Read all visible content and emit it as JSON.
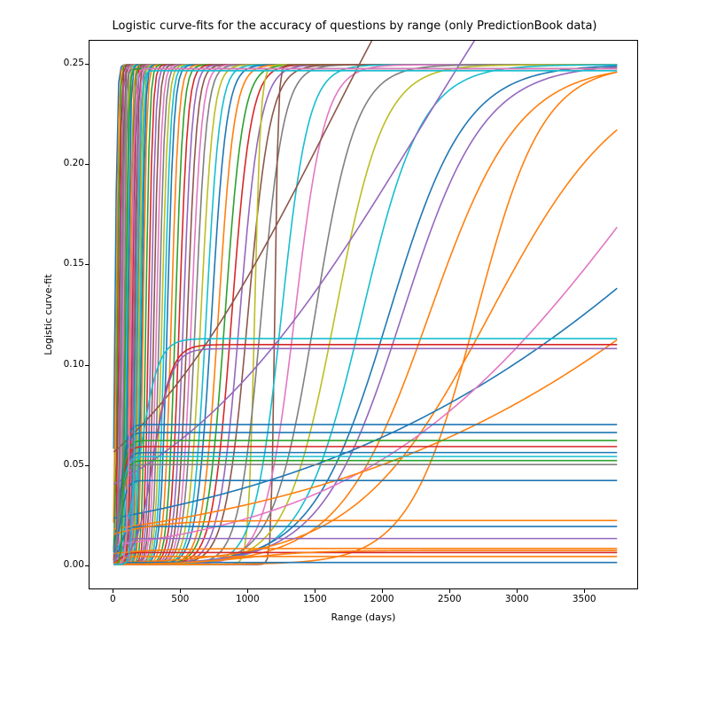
{
  "chart_data": {
    "type": "line",
    "title": "Logistic curve-fits for the accuracy of questions by range (only PredictionBook data)",
    "xlabel": "Range (days)",
    "ylabel": "Logistic curve-fit",
    "xlim": [
      -180,
      3900
    ],
    "ylim": [
      -0.012,
      0.262
    ],
    "xticks": [
      0,
      500,
      1000,
      1500,
      2000,
      2500,
      3000,
      3500
    ],
    "yticks": [
      0.0,
      0.05,
      0.1,
      0.15,
      0.2,
      0.25
    ],
    "ytick_labels": [
      "0.00",
      "0.05",
      "0.10",
      "0.15",
      "0.20",
      "0.25"
    ],
    "colors": [
      "#1f77b4",
      "#ff7f0e",
      "#2ca02c",
      "#d62728",
      "#9467bd",
      "#8c564b",
      "#e377c2",
      "#7f7f7f",
      "#bcbd22",
      "#17becf"
    ],
    "series": [
      {
        "x0": 10,
        "k": 0.12,
        "L": 0.25,
        "c": 0
      },
      {
        "x0": 20,
        "k": 0.12,
        "L": 0.25,
        "c": 1
      },
      {
        "x0": 30,
        "k": 0.12,
        "L": 0.25,
        "c": 2
      },
      {
        "x0": 40,
        "k": 0.12,
        "L": 0.25,
        "c": 3
      },
      {
        "x0": 50,
        "k": 0.12,
        "L": 0.25,
        "c": 4
      },
      {
        "x0": 60,
        "k": 0.12,
        "L": 0.25,
        "c": 5
      },
      {
        "x0": 70,
        "k": 0.12,
        "L": 0.25,
        "c": 6
      },
      {
        "x0": 80,
        "k": 0.12,
        "L": 0.25,
        "c": 7
      },
      {
        "x0": 90,
        "k": 0.12,
        "L": 0.25,
        "c": 8
      },
      {
        "x0": 100,
        "k": 0.12,
        "L": 0.25,
        "c": 9
      },
      {
        "x0": 110,
        "k": 0.12,
        "L": 0.25,
        "c": 0
      },
      {
        "x0": 120,
        "k": 0.1,
        "L": 0.25,
        "c": 1
      },
      {
        "x0": 130,
        "k": 0.1,
        "L": 0.25,
        "c": 2
      },
      {
        "x0": 140,
        "k": 0.095,
        "L": 0.25,
        "c": 3
      },
      {
        "x0": 150,
        "k": 0.095,
        "L": 0.25,
        "c": 4
      },
      {
        "x0": 160,
        "k": 0.09,
        "L": 0.25,
        "c": 5
      },
      {
        "x0": 170,
        "k": 0.09,
        "L": 0.25,
        "c": 6
      },
      {
        "x0": 180,
        "k": 0.085,
        "L": 0.25,
        "c": 7
      },
      {
        "x0": 190,
        "k": 0.085,
        "L": 0.25,
        "c": 8
      },
      {
        "x0": 200,
        "k": 0.08,
        "L": 0.25,
        "c": 9
      },
      {
        "x0": 210,
        "k": 0.08,
        "L": 0.25,
        "c": 0
      },
      {
        "x0": 220,
        "k": 0.075,
        "L": 0.25,
        "c": 1
      },
      {
        "x0": 240,
        "k": 0.07,
        "L": 0.25,
        "c": 2
      },
      {
        "x0": 260,
        "k": 0.065,
        "L": 0.25,
        "c": 3
      },
      {
        "x0": 280,
        "k": 0.06,
        "L": 0.25,
        "c": 4
      },
      {
        "x0": 300,
        "k": 0.055,
        "L": 0.25,
        "c": 5
      },
      {
        "x0": 320,
        "k": 0.05,
        "L": 0.25,
        "c": 6
      },
      {
        "x0": 340,
        "k": 0.048,
        "L": 0.25,
        "c": 7
      },
      {
        "x0": 360,
        "k": 0.045,
        "L": 0.25,
        "c": 8
      },
      {
        "x0": 380,
        "k": 0.042,
        "L": 0.25,
        "c": 9
      },
      {
        "x0": 400,
        "k": 0.04,
        "L": 0.25,
        "c": 0
      },
      {
        "x0": 430,
        "k": 0.037,
        "L": 0.25,
        "c": 1
      },
      {
        "x0": 460,
        "k": 0.035,
        "L": 0.25,
        "c": 2
      },
      {
        "x0": 490,
        "k": 0.032,
        "L": 0.25,
        "c": 3
      },
      {
        "x0": 520,
        "k": 0.03,
        "L": 0.25,
        "c": 4
      },
      {
        "x0": 550,
        "k": 0.028,
        "L": 0.25,
        "c": 5
      },
      {
        "x0": 580,
        "k": 0.026,
        "L": 0.25,
        "c": 6
      },
      {
        "x0": 610,
        "k": 0.024,
        "L": 0.25,
        "c": 7
      },
      {
        "x0": 650,
        "k": 0.022,
        "L": 0.25,
        "c": 8
      },
      {
        "x0": 690,
        "k": 0.02,
        "L": 0.25,
        "c": 9
      },
      {
        "x0": 730,
        "k": 0.018,
        "L": 0.25,
        "c": 0
      },
      {
        "x0": 780,
        "k": 0.017,
        "L": 0.25,
        "c": 1
      },
      {
        "x0": 830,
        "k": 0.015,
        "L": 0.25,
        "c": 2
      },
      {
        "x0": 880,
        "k": 0.014,
        "L": 0.25,
        "c": 3
      },
      {
        "x0": 940,
        "k": 0.013,
        "L": 0.25,
        "c": 4
      },
      {
        "x0": 1000,
        "k": 0.012,
        "L": 0.25,
        "c": 5
      },
      {
        "x0": 1050,
        "k": 0.045,
        "L": 0.25,
        "c": 8
      },
      {
        "x0": 1100,
        "k": 0.012,
        "L": 0.25,
        "c": 7
      },
      {
        "x0": 1200,
        "k": 0.08,
        "L": 0.25,
        "c": 5
      },
      {
        "x0": 1250,
        "k": 0.01,
        "L": 0.25,
        "c": 9
      },
      {
        "x0": 1350,
        "k": 0.009,
        "L": 0.25,
        "c": 6
      },
      {
        "x0": 1500,
        "k": 0.0065,
        "L": 0.25,
        "c": 7
      },
      {
        "x0": 1650,
        "k": 0.0055,
        "L": 0.25,
        "c": 8
      },
      {
        "x0": 1850,
        "k": 0.0045,
        "L": 0.25,
        "c": 9
      },
      {
        "x0": 2050,
        "k": 0.0035,
        "L": 0.25,
        "c": 0
      },
      {
        "x0": 2150,
        "k": 0.0033,
        "L": 0.25,
        "c": 4
      },
      {
        "x0": 2350,
        "k": 0.003,
        "L": 0.25,
        "c": 1
      },
      {
        "x0": 2700,
        "k": 0.004,
        "L": 0.25,
        "c": 1
      },
      {
        "x0": 2800,
        "k": 0.002,
        "L": 0.25,
        "c": 1
      },
      {
        "x0": 1600,
        "k": 0.0012,
        "L": 0.44,
        "c": 5
      },
      {
        "x0": 2300,
        "k": 0.001,
        "L": 0.44,
        "c": 4
      },
      {
        "x0": 5500,
        "k": 0.00055,
        "L": 0.5,
        "c": 0
      },
      {
        "x0": 4100,
        "k": 0.0009,
        "L": 0.4,
        "c": 6
      },
      {
        "x0": 6000,
        "k": 0.00055,
        "L": 0.5,
        "c": 1
      },
      {
        "x0": 200,
        "k": 0.015,
        "L": 0.113,
        "c": 9
      },
      {
        "x0": 300,
        "k": 0.015,
        "L": 0.11,
        "c": 3
      },
      {
        "x0": 300,
        "k": 0.015,
        "L": 0.108,
        "c": 4
      },
      {
        "x0": 50,
        "k": 0.04,
        "L": 0.07,
        "c": 0
      },
      {
        "x0": 50,
        "k": 0.04,
        "L": 0.066,
        "c": 0
      },
      {
        "x0": 50,
        "k": 0.04,
        "L": 0.062,
        "c": 2
      },
      {
        "x0": 50,
        "k": 0.04,
        "L": 0.059,
        "c": 3
      },
      {
        "x0": 50,
        "k": 0.04,
        "L": 0.056,
        "c": 0
      },
      {
        "x0": 50,
        "k": 0.04,
        "L": 0.054,
        "c": 9
      },
      {
        "x0": 50,
        "k": 0.04,
        "L": 0.052,
        "c": 2
      },
      {
        "x0": 50,
        "k": 0.04,
        "L": 0.05,
        "c": 7
      },
      {
        "x0": 50,
        "k": 0.04,
        "L": 0.042,
        "c": 0
      },
      {
        "x0": 50,
        "k": 0.04,
        "L": 0.019,
        "c": 0
      },
      {
        "x0": 50,
        "k": 0.04,
        "L": 0.013,
        "c": 4
      },
      {
        "x0": 50,
        "k": 0.04,
        "L": 0.006,
        "c": 3
      },
      {
        "x0": 50,
        "k": 0.04,
        "L": 0.004,
        "c": 1
      },
      {
        "x0": 50,
        "k": 0.04,
        "L": 0.001,
        "c": 0
      },
      {
        "x0": -200,
        "k": 0.004,
        "L": 0.008,
        "c": 1
      },
      {
        "x0": -200,
        "k": 0.004,
        "L": 0.022,
        "c": 1
      },
      {
        "x0": 1000,
        "k": 0.004,
        "L": 0.007,
        "c": 1
      },
      {
        "x0": 60,
        "k": 0.09,
        "L": 0.248,
        "c": 7
      },
      {
        "x0": 90,
        "k": 0.1,
        "L": 0.248,
        "c": 2
      },
      {
        "x0": 130,
        "k": 0.08,
        "L": 0.248,
        "c": 6
      },
      {
        "x0": 170,
        "k": 0.07,
        "L": 0.247,
        "c": 9
      }
    ],
    "x_domain": [
      0,
      3750
    ]
  }
}
